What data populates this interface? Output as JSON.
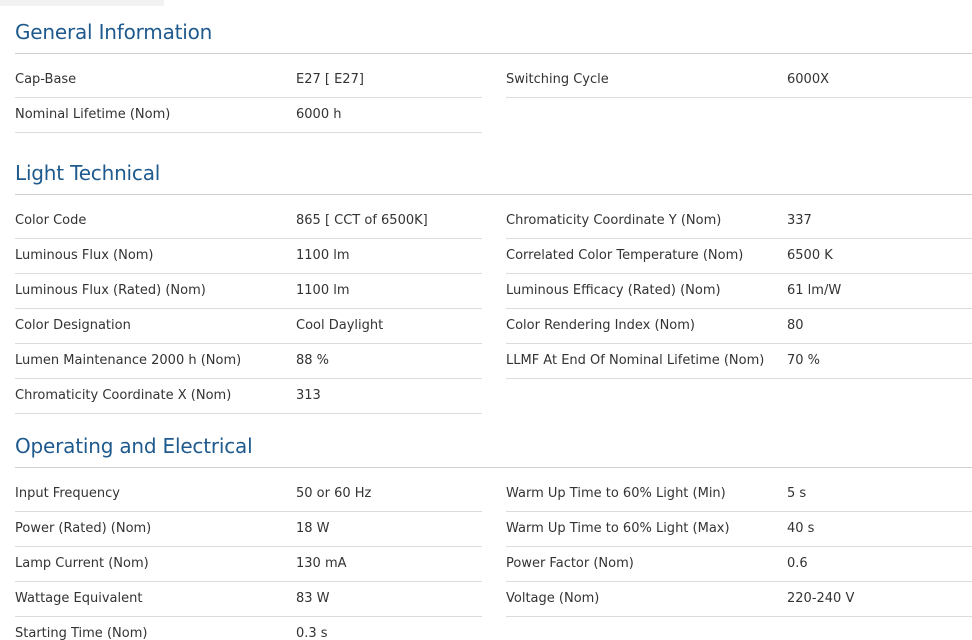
{
  "sections": [
    {
      "title": "General Information",
      "left": [
        {
          "label": "Cap-Base",
          "value": "E27  [ E27]"
        },
        {
          "label": "Nominal Lifetime (Nom)",
          "value": "6000 h"
        }
      ],
      "right": [
        {
          "label": "Switching Cycle",
          "value": "6000X"
        }
      ]
    },
    {
      "title": "Light Technical",
      "left": [
        {
          "label": "Color Code",
          "value": "865  [ CCT of 6500K]"
        },
        {
          "label": "Luminous Flux (Nom)",
          "value": "1100 lm"
        },
        {
          "label": "Luminous Flux (Rated) (Nom)",
          "value": "1100 lm"
        },
        {
          "label": "Color Designation",
          "value": "Cool Daylight"
        },
        {
          "label": "Lumen Maintenance 2000 h (Nom)",
          "value": "88 %"
        },
        {
          "label": "Chromaticity Coordinate X (Nom)",
          "value": "313"
        }
      ],
      "right": [
        {
          "label": "Chromaticity Coordinate Y (Nom)",
          "value": "337"
        },
        {
          "label": "Correlated Color Temperature (Nom)",
          "value": "6500 K"
        },
        {
          "label": "Luminous Efficacy (Rated) (Nom)",
          "value": "61 lm/W"
        },
        {
          "label": "Color Rendering Index (Nom)",
          "value": "80"
        },
        {
          "label": "LLMF At End Of Nominal Lifetime (Nom)",
          "value": "70 %"
        }
      ]
    },
    {
      "title": "Operating and Electrical",
      "left": [
        {
          "label": "Input Frequency",
          "value": "50 or 60 Hz"
        },
        {
          "label": "Power (Rated) (Nom)",
          "value": "18 W"
        },
        {
          "label": "Lamp Current (Nom)",
          "value": "130 mA"
        },
        {
          "label": "Wattage Equivalent",
          "value": "83 W"
        },
        {
          "label": "Starting Time (Nom)",
          "value": "0.3 s"
        }
      ],
      "right": [
        {
          "label": "Warm Up Time to 60% Light (Min)",
          "value": "5 s"
        },
        {
          "label": "Warm Up Time to 60% Light (Max)",
          "value": "40 s"
        },
        {
          "label": "Power Factor (Nom)",
          "value": "0.6"
        },
        {
          "label": "Voltage (Nom)",
          "value": "220-240 V"
        }
      ]
    }
  ],
  "colors": {
    "heading": "#1f5a8e",
    "text": "#333333",
    "rule": "#cfcfcf",
    "row_divider": "#dcdcdc"
  }
}
